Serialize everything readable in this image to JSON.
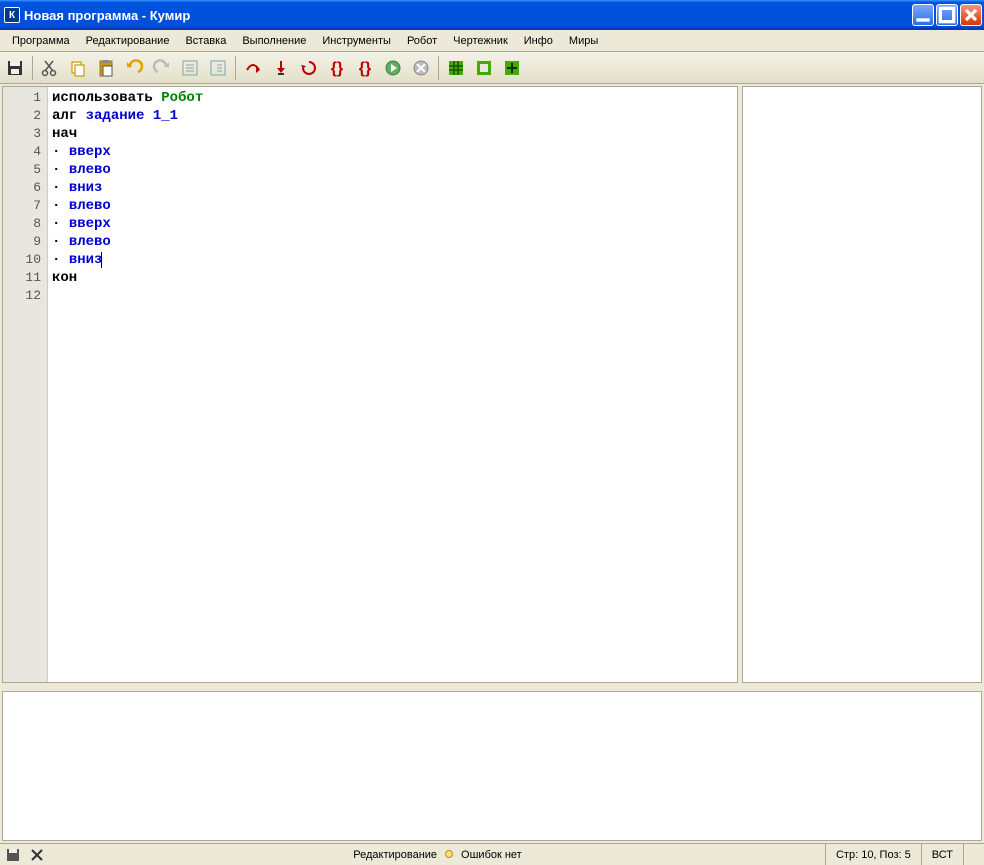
{
  "window": {
    "title": "Новая программа - Кумир",
    "icon_letter": "К"
  },
  "menu": {
    "items": [
      "Программа",
      "Редактирование",
      "Вставка",
      "Выполнение",
      "Инструменты",
      "Робот",
      "Чертежник",
      "Инфо",
      "Миры"
    ]
  },
  "toolbar_icons": [
    "save-icon",
    "cut-icon",
    "copy-icon",
    "paste-icon",
    "undo-icon",
    "redo-icon",
    "indent-out-icon",
    "indent-in-icon",
    "step-over-icon",
    "step-into-icon",
    "step-back-icon",
    "step-brace-l-icon",
    "step-brace-r-icon",
    "run-icon",
    "stop-icon",
    "grid-all-icon",
    "grid-outline-icon",
    "grid-plus-icon"
  ],
  "code": {
    "lines": [
      {
        "n": 1,
        "tokens": [
          {
            "t": "kw",
            "v": "использовать "
          },
          {
            "t": "green",
            "v": "Робот"
          }
        ]
      },
      {
        "n": 2,
        "tokens": [
          {
            "t": "kw",
            "v": "алг "
          },
          {
            "t": "blue",
            "v": "задание 1_1"
          }
        ]
      },
      {
        "n": 3,
        "tokens": [
          {
            "t": "kw",
            "v": "нач"
          }
        ]
      },
      {
        "n": 4,
        "tokens": [
          {
            "t": "bullet",
            "v": "· "
          },
          {
            "t": "blue",
            "v": "вверх"
          }
        ]
      },
      {
        "n": 5,
        "tokens": [
          {
            "t": "bullet",
            "v": "· "
          },
          {
            "t": "blue",
            "v": "влево"
          }
        ]
      },
      {
        "n": 6,
        "tokens": [
          {
            "t": "bullet",
            "v": "· "
          },
          {
            "t": "blue",
            "v": "вниз"
          }
        ]
      },
      {
        "n": 7,
        "tokens": [
          {
            "t": "bullet",
            "v": "· "
          },
          {
            "t": "blue",
            "v": "влево"
          }
        ]
      },
      {
        "n": 8,
        "tokens": [
          {
            "t": "bullet",
            "v": "· "
          },
          {
            "t": "blue",
            "v": "вверх"
          }
        ]
      },
      {
        "n": 9,
        "tokens": [
          {
            "t": "bullet",
            "v": "· "
          },
          {
            "t": "blue",
            "v": "влево"
          }
        ]
      },
      {
        "n": 10,
        "tokens": [
          {
            "t": "bullet",
            "v": "· "
          },
          {
            "t": "blue",
            "v": "вниз"
          }
        ],
        "caret": true
      },
      {
        "n": 11,
        "tokens": [
          {
            "t": "kw",
            "v": "кон"
          }
        ]
      },
      {
        "n": 12,
        "tokens": []
      }
    ]
  },
  "status": {
    "mode": "Редактирование",
    "errors": "Ошибок нет",
    "pos": "Стр: 10, Поз: 5",
    "ins": "ВСТ"
  }
}
